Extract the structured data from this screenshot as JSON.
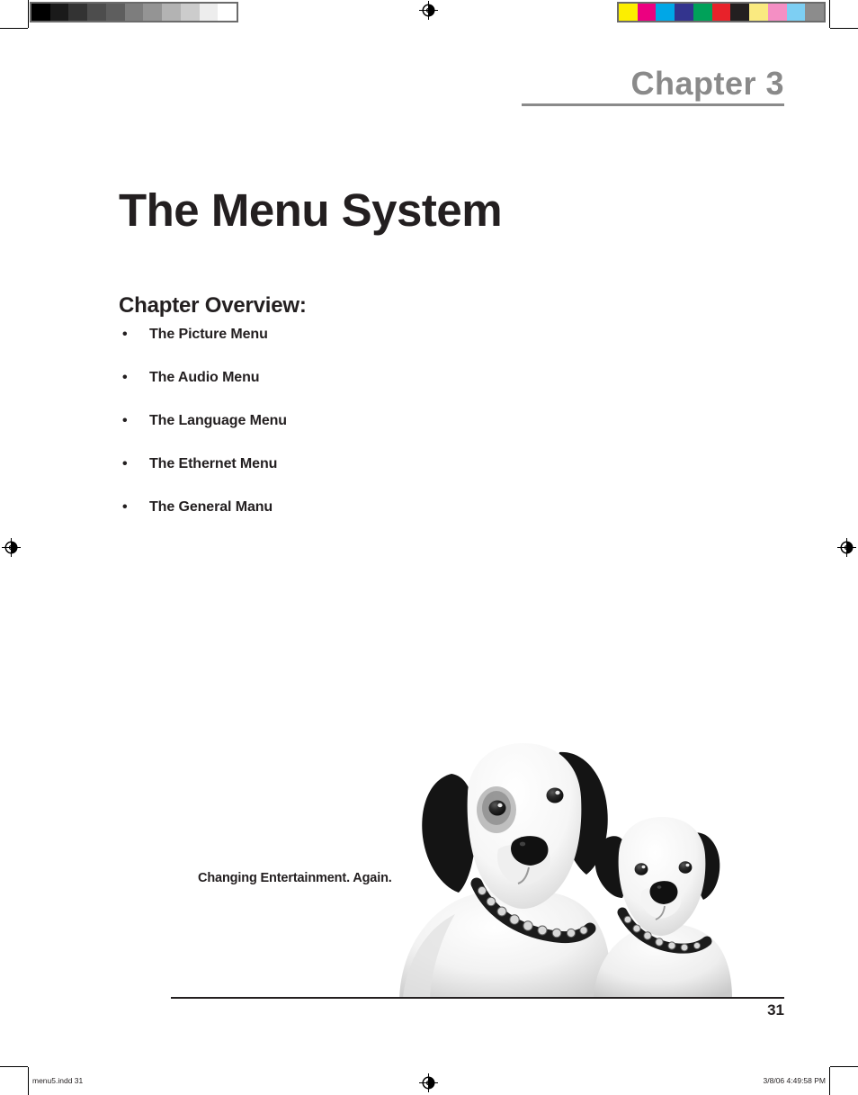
{
  "document": {
    "page_background": "#ffffff",
    "text_color": "#231f20"
  },
  "chapter_header": {
    "label": "Chapter 3",
    "color": "#8a8a8a",
    "rule_color": "#8a8a8a"
  },
  "title": {
    "text": "The Menu System"
  },
  "overview": {
    "heading": "Chapter Overview:",
    "bullet_glyph": "•",
    "items": [
      {
        "label": "The Picture Menu"
      },
      {
        "label": "The Audio Menu"
      },
      {
        "label": "The Language Menu"
      },
      {
        "label": "The Ethernet Menu"
      },
      {
        "label": "The General Manu"
      }
    ]
  },
  "brand": {
    "tagline": "Changing Entertainment. Again.",
    "artwork_name": "two-dogs-photo"
  },
  "footer": {
    "page_number": "31",
    "rule_color": "#231f20"
  },
  "slug": {
    "file_name": "menu5.indd   31",
    "timestamp": "3/8/06   4:49:58 PM"
  },
  "printer_marks": {
    "grayscale_bar": {
      "border": "#6b6b6b",
      "swatches": [
        "#000000",
        "#1a1a1a",
        "#333333",
        "#4d4d4d",
        "#5e5e5e",
        "#7d7d7d",
        "#949494",
        "#b3b3b3",
        "#cccccc",
        "#ededed",
        "#ffffff"
      ]
    },
    "color_bar": {
      "border": "#6b6b6b",
      "swatches": [
        "#fcee00",
        "#ec0080",
        "#00a7e7",
        "#33348e",
        "#00a159",
        "#e8222a",
        "#231f20",
        "#faea80",
        "#f48fc4",
        "#7dcff3",
        "#8c8c8c"
      ]
    },
    "registration_mark_name": "registration-target-mark",
    "crop_mark_color": "#000000"
  }
}
